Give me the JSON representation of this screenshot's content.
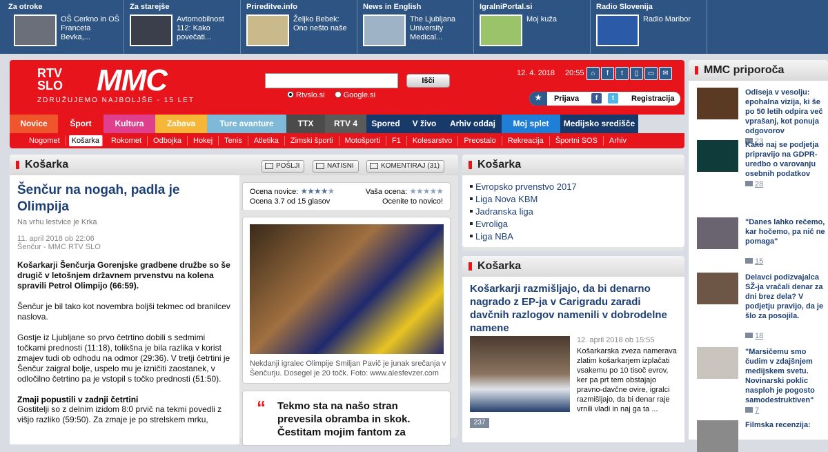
{
  "topbar": [
    {
      "title": "Za otroke",
      "text": "OŠ Cerkno in OŠ Franceta Bevka,...",
      "color": "#6b6f7a"
    },
    {
      "title": "Za starejše",
      "text": "Avtomobilnost 112: Kako povečati...",
      "color": "#3a3f4b"
    },
    {
      "title": "Prireditve.info",
      "text": "Željko Bebek: Ono nešto naše",
      "color": "#c9b98b"
    },
    {
      "title": "News in English",
      "text": "The Ljubljana University Medical...",
      "color": "#9fb3c6"
    },
    {
      "title": "IgralniPortal.si",
      "text": "Moj kuža",
      "color": "#9bc46a"
    },
    {
      "title": "Radio Slovenija",
      "text": "Radio Maribor",
      "color": "#2a5aa8"
    }
  ],
  "header": {
    "logo_rtv_line1": "RTV",
    "logo_rtv_line2": "SLO",
    "logo_mmc": "MMC",
    "tagline": "ZDRUŽUJEMO NAJBOLJŠE - 15 LET",
    "search_placeholder": "",
    "search_button": "Išči",
    "radio_1": "Rtvslo.si",
    "radio_2": "Google.si",
    "date": "12. 4. 2018",
    "time": "20:55",
    "login": "Prijava",
    "register": "Registracija"
  },
  "nav": [
    {
      "label": "Novice",
      "color": "#f0562c",
      "width": 70
    },
    {
      "label": "Šport",
      "color": "#e8141c",
      "width": 66
    },
    {
      "label": "Kultura",
      "color": "#df3f8c",
      "width": 75
    },
    {
      "label": "Zabava",
      "color": "#f6b638",
      "width": 75
    },
    {
      "label": "Ture avanture",
      "color": "#7fb9d8",
      "width": 115
    },
    {
      "label": "TTX",
      "color": "#4b4b4b",
      "width": 56
    },
    {
      "label": "RTV 4",
      "color": "#5a5a5a",
      "width": 60
    },
    {
      "label": "Spored",
      "color": "#173a6a",
      "width": 56
    },
    {
      "label": "V živo",
      "color": "#173a6a",
      "width": 56
    },
    {
      "label": "Arhiv oddaj",
      "color": "#173a6a",
      "width": 84
    },
    {
      "label": "Moj splet",
      "color": "#1f7fd6",
      "width": 85
    },
    {
      "label": "Medijsko središče",
      "color": "#173a6a",
      "width": 113
    }
  ],
  "subnav": [
    "Nogomet",
    "Košarka",
    "Rokomet",
    "Odbojka",
    "Hokej",
    "Tenis",
    "Atletika",
    "Zimski športi",
    "Motošporti",
    "F1",
    "Kolesarstvo",
    "Preostalo",
    "Rekreacija",
    "Športni SOS",
    "Arhiv"
  ],
  "subnav_active": "Košarka",
  "article": {
    "section": "Košarka",
    "btn_send": "POŠLJI",
    "btn_print": "NATISNI",
    "btn_comment": "KOMENTIRAJ",
    "comment_count": "(31)",
    "title": "Šenčur na nogah, padla je Olimpija",
    "subtitle": "Na vrhu lestvice je Krka",
    "date": "11. april 2018 ob 22:06",
    "source": "Šenčur - MMC RTV SLO",
    "lead": "Košarkarji Šenčurja Gorenjske gradbene družbe so še drugič v letošnjem državnem prvenstvu na kolena spravili Petrol Olimpijo (66:59).",
    "p1": "Šenčur je bil tako kot novembra boljši tekmec od branilcev naslova.",
    "p2": "Gostje iz Ljubljane so prvo četrtino dobili s sedmimi točkami prednosti (11:18), tolikšna je bila razlika v korist zmajev tudi ob odhodu na odmor (29:36). V tretji četrtini je Šenčur zaigral bolje, uspelo mu je izničiti zaostanek, v odločilno četrtino pa je vstopil s točko prednosti (51:50).",
    "h": "Zmaji popustili v zadnji četrtini",
    "p3": "Gostitelji so z delnim izidom 8:0 prvič na tekmi povedli z višjo razliko (59:50). Za zmaje je po strelskem mrku,",
    "rating_label": "Ocena novice:",
    "rating_value": 3.7,
    "rating_text": "Ocena 3.7 od 15 glasov",
    "your_rating_label": "Vaša ocena:",
    "your_rating_text": "Ocenite to novico!",
    "photo_caption": "Nekdanji igralec Olimpije Smiljan Pavič je junak srečanja v Šenčurju. Dosegel je 20 točk. Foto: www.alesfevzer.com",
    "quote": "Tekmo sta na našo stran prevesila obramba in skok. Čestitam mojim fantom za"
  },
  "links": {
    "section": "Košarka",
    "items": [
      "Evropsko prvenstvo 2017",
      "Liga Nova KBM",
      "Jadranska liga",
      "Evroliga",
      "Liga NBA"
    ]
  },
  "news": {
    "section": "Košarka",
    "title": "Košarkarji razmišljajo, da bi denarno nagrado z EP-ja v Carigradu zaradi davčnih razlogov namenili v dobrodelne namene",
    "date": "12. april 2018 ob 15:55",
    "text": "Košarkarska zveza namerava zlatim košarkarjem izplačati vsakemu po 10 tisoč evrov, ker pa prt tem obstajajo pravno-davčne ovire, igralci razmišljajo, da bi denar raje vrnili vladi in naj ga ta ...",
    "count": "237"
  },
  "recommend": {
    "section": "MMC priporoča",
    "items": [
      {
        "title": "Odiseja v vesolju: epohalna vizija, ki še po 50 letih odpira več vprašanj, kot ponuja odgovorov",
        "count": "23",
        "color": "#5a3a22"
      },
      {
        "title": "Kako naj se podjetja pripravijo na GDPR-uredbo o varovanju osebnih podatkov",
        "count": "28",
        "color": "#0f3b3a"
      },
      {
        "title": "\"Danes lahko rečemo, kar hočemo, pa nič ne pomaga\"",
        "count": "15",
        "color": "#6a6470"
      },
      {
        "title": "Delavci podizvajalca SŽ-ja vračali denar za dni brez dela? V podjetju pravijo, da je šlo za posojila.",
        "count": "18",
        "color": "#6e5646"
      },
      {
        "title": "\"Marsičemu smo čudim v zdajšnjem medijskem svetu. Novinarski poklic nasploh je pogosto samodestruktiven\"",
        "count": "7",
        "color": "#c9c4be"
      },
      {
        "title": "Filmska recenzija:",
        "count": "",
        "color": "#8a8a8a"
      }
    ]
  }
}
